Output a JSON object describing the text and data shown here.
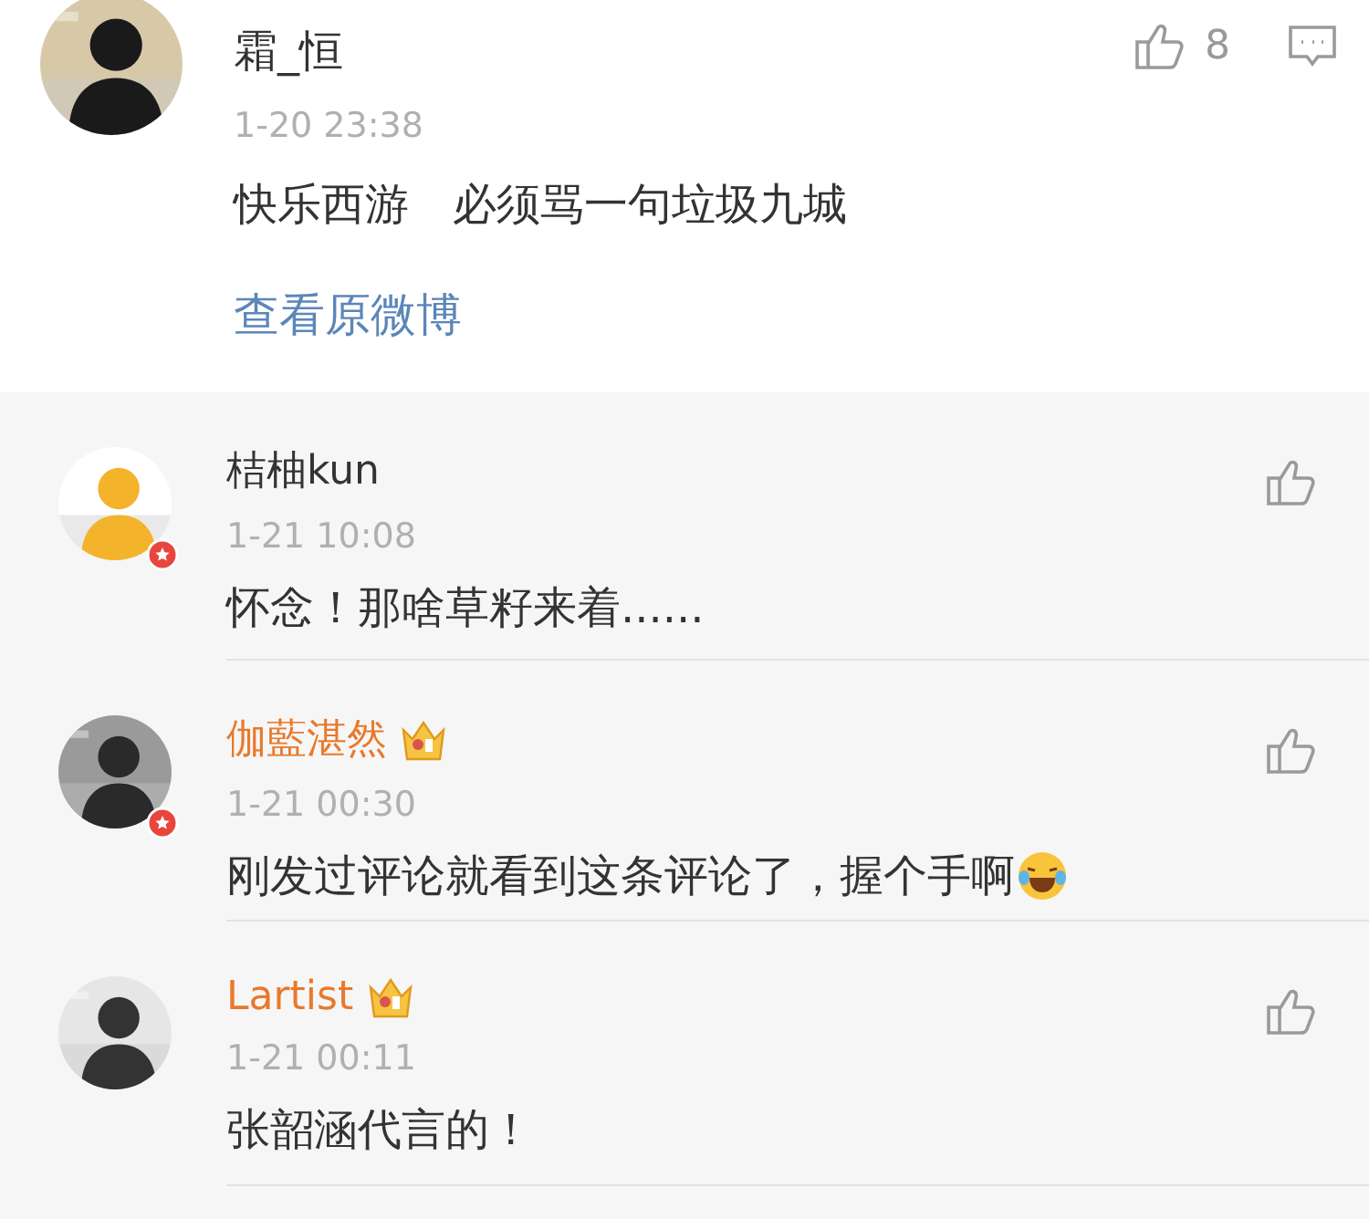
{
  "post": {
    "name": "霜_恒",
    "time": "1-20 23:38",
    "text": "快乐西游　必须骂一句垃圾九城",
    "link": "查看原微博",
    "likes": "8"
  },
  "replies": [
    {
      "name": "桔柚kun",
      "vip": false,
      "verified": true,
      "time": "1-21 10:08",
      "text": "怀念！那啥草籽来着......",
      "emoji": false
    },
    {
      "name": "伽藍湛然",
      "vip": true,
      "verified": true,
      "time": "1-21 00:30",
      "text": "刚发过评论就看到这条评论了，握个手啊",
      "emoji": true
    },
    {
      "name": "Lartist",
      "vip": true,
      "verified": false,
      "time": "1-21 00:11",
      "text": "张韶涵代言的！",
      "emoji": false
    }
  ]
}
